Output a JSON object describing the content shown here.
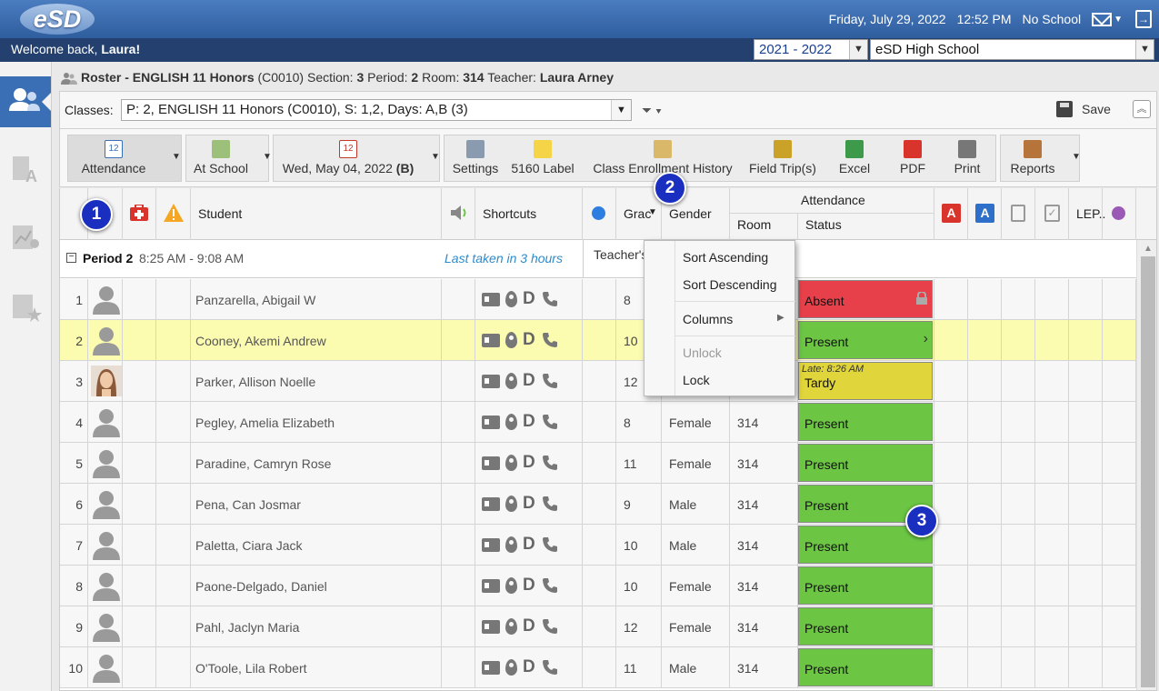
{
  "app": {
    "logo": "eSD"
  },
  "topbar": {
    "date": "Friday, July 29, 2022",
    "time": "12:52 PM",
    "school_status": "No School"
  },
  "welcome": {
    "prefix": "Welcome back,",
    "name": "Laura!"
  },
  "year_select": {
    "value": "2021 - 2022"
  },
  "school_select": {
    "value": "eSD High School"
  },
  "roster": {
    "title_prefix": "Roster - ",
    "course": "ENGLISH 11 Honors",
    "code": "(C0010)",
    "section_label": " Section: ",
    "section": "3",
    "period_label": " Period: ",
    "period": "2",
    "room_label": " Room: ",
    "room": "314",
    "teacher_label": " Teacher: ",
    "teacher": "Laura Arney"
  },
  "classes": {
    "label": "Classes:",
    "value": "P: 2, ENGLISH 11 Honors (C0010), S: 1,2, Days: A,B (3)",
    "save_label": "Save"
  },
  "toolbar": {
    "attendance": "Attendance",
    "at_school": "At School",
    "date": "Wed, May 04, 2022",
    "date_suffix": "(B)",
    "settings": "Settings",
    "label_5160": "5160 Label",
    "class_enrollment_history": "Class Enrollment History",
    "field_trips": "Field Trip(s)",
    "excel": "Excel",
    "pdf": "PDF",
    "print": "Print",
    "reports": "Reports"
  },
  "headers": {
    "student": "Student",
    "shortcuts": "Shortcuts",
    "grade": "Grac",
    "gender": "Gender",
    "attendance": "Attendance",
    "room": "Room",
    "status": "Status",
    "lep": "LEP..",
    "teachers": "Teacher's"
  },
  "period": {
    "label": "Period 2",
    "time": "8:25 AM - 9:08 AM",
    "last_taken": "Last taken in 3 hours"
  },
  "students": [
    {
      "num": "1",
      "name": "Panzarella, Abigail W",
      "grade": "8",
      "gender": "",
      "room": "",
      "status": "Absent",
      "note": ""
    },
    {
      "num": "2",
      "name": "Cooney, Akemi Andrew",
      "grade": "10",
      "gender": "",
      "room": "",
      "status": "Present",
      "note": ""
    },
    {
      "num": "3",
      "name": "Parker, Allison Noelle",
      "grade": "12",
      "gender": "",
      "room": "",
      "status": "Tardy",
      "note": "Late: 8:26 AM"
    },
    {
      "num": "4",
      "name": "Pegley, Amelia Elizabeth",
      "grade": "8",
      "gender": "Female",
      "room": "314",
      "status": "Present",
      "note": ""
    },
    {
      "num": "5",
      "name": "Paradine, Camryn Rose",
      "grade": "11",
      "gender": "Female",
      "room": "314",
      "status": "Present",
      "note": ""
    },
    {
      "num": "6",
      "name": "Pena, Can Josmar",
      "grade": "9",
      "gender": "Male",
      "room": "314",
      "status": "Present",
      "note": ""
    },
    {
      "num": "7",
      "name": "Paletta, Ciara Jack",
      "grade": "10",
      "gender": "Male",
      "room": "314",
      "status": "Present",
      "note": ""
    },
    {
      "num": "8",
      "name": "Paone-Delgado, Daniel",
      "grade": "10",
      "gender": "Female",
      "room": "314",
      "status": "Present",
      "note": ""
    },
    {
      "num": "9",
      "name": "Pahl, Jaclyn Maria",
      "grade": "12",
      "gender": "Female",
      "room": "314",
      "status": "Present",
      "note": ""
    },
    {
      "num": "10",
      "name": "O'Toole, Lila Robert",
      "grade": "11",
      "gender": "Male",
      "room": "314",
      "status": "Present",
      "note": ""
    }
  ],
  "context_menu": {
    "sort_ascending": "Sort Ascending",
    "sort_descending": "Sort Descending",
    "columns": "Columns",
    "unlock": "Unlock",
    "lock": "Lock"
  },
  "callouts": {
    "one": "1",
    "two": "2",
    "three": "3"
  },
  "colors": {
    "absent": "#e8404a",
    "present": "#6cc644",
    "tardy": "#e0d53a",
    "selected_row": "#fcfcb0",
    "callout": "#1a2fbf"
  }
}
